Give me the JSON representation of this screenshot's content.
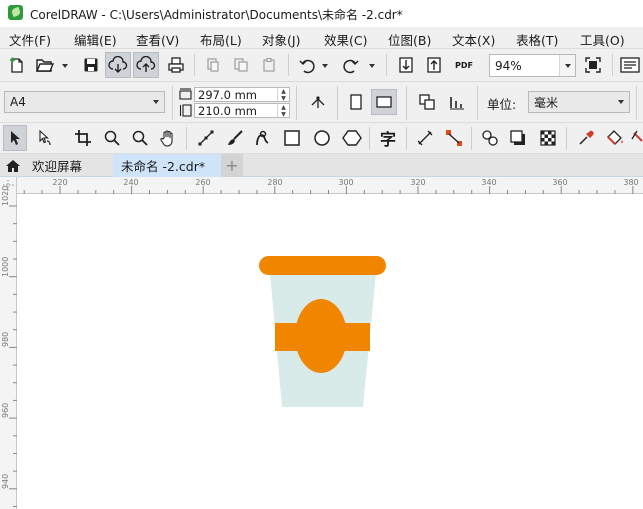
{
  "window": {
    "title": "CorelDRAW - C:\\Users\\Administrator\\Documents\\未命名 -2.cdr*"
  },
  "menu": [
    "文件(F)",
    "编辑(E)",
    "查看(V)",
    "布局(L)",
    "对象(J)",
    "效果(C)",
    "位图(B)",
    "文本(X)",
    "表格(T)",
    "工具(O)"
  ],
  "standard_toolbar": {
    "zoom_value": "94%",
    "pdf_label": "PDF",
    "icons": [
      "new-document-icon",
      "open-folder-icon",
      "save-icon",
      "cloud-download-icon",
      "cloud-upload-icon",
      "print-icon",
      "cut-icon",
      "copy-icon",
      "paste-icon",
      "undo-icon",
      "redo-icon",
      "import-icon",
      "export-icon",
      "publish-pdf-icon",
      "zoom-to-page-icon",
      "options-icon"
    ]
  },
  "property_bar": {
    "page_size": "A4",
    "width": "297.0 mm",
    "height": "210.0 mm",
    "units_label": "单位:",
    "units_value": "毫米",
    "icons": [
      "page-width-icon",
      "page-height-icon",
      "all-pages-icon",
      "current-page-icon",
      "portrait-icon",
      "landscape-icon",
      "nudge-icon"
    ]
  },
  "toolbox": {
    "icons": [
      "pick-tool-icon",
      "shape-tool-icon",
      "crop-tool-icon",
      "zoom-tool-icon",
      "zoom-out-icon",
      "pan-tool-icon",
      "freehand-tool-icon",
      "artistic-media-icon",
      "smart-drawing-icon",
      "rectangle-tool-icon",
      "ellipse-tool-icon",
      "polygon-tool-icon",
      "text-tool-icon",
      "parallel-dimension-icon",
      "connector-tool-icon",
      "blend-tool-icon",
      "drop-shadow-icon",
      "transparency-icon",
      "eyedropper-icon",
      "fill-tool-icon"
    ],
    "text_tool_glyph": "字"
  },
  "tabs": [
    {
      "label": "欢迎屏幕"
    },
    {
      "label": "未命名 -2.cdr*"
    }
  ],
  "add_tab_glyph": "+",
  "ruler": {
    "horizontal": [
      "220",
      "240",
      "260",
      "280",
      "300",
      "320",
      "340",
      "360",
      "380"
    ],
    "vertical": [
      "1020",
      "1000",
      "980",
      "960",
      "940"
    ]
  },
  "drawing": {
    "cup_lid_color": "#f08500",
    "cup_body_color": "#d9ebe9",
    "band_color": "#f08500"
  }
}
